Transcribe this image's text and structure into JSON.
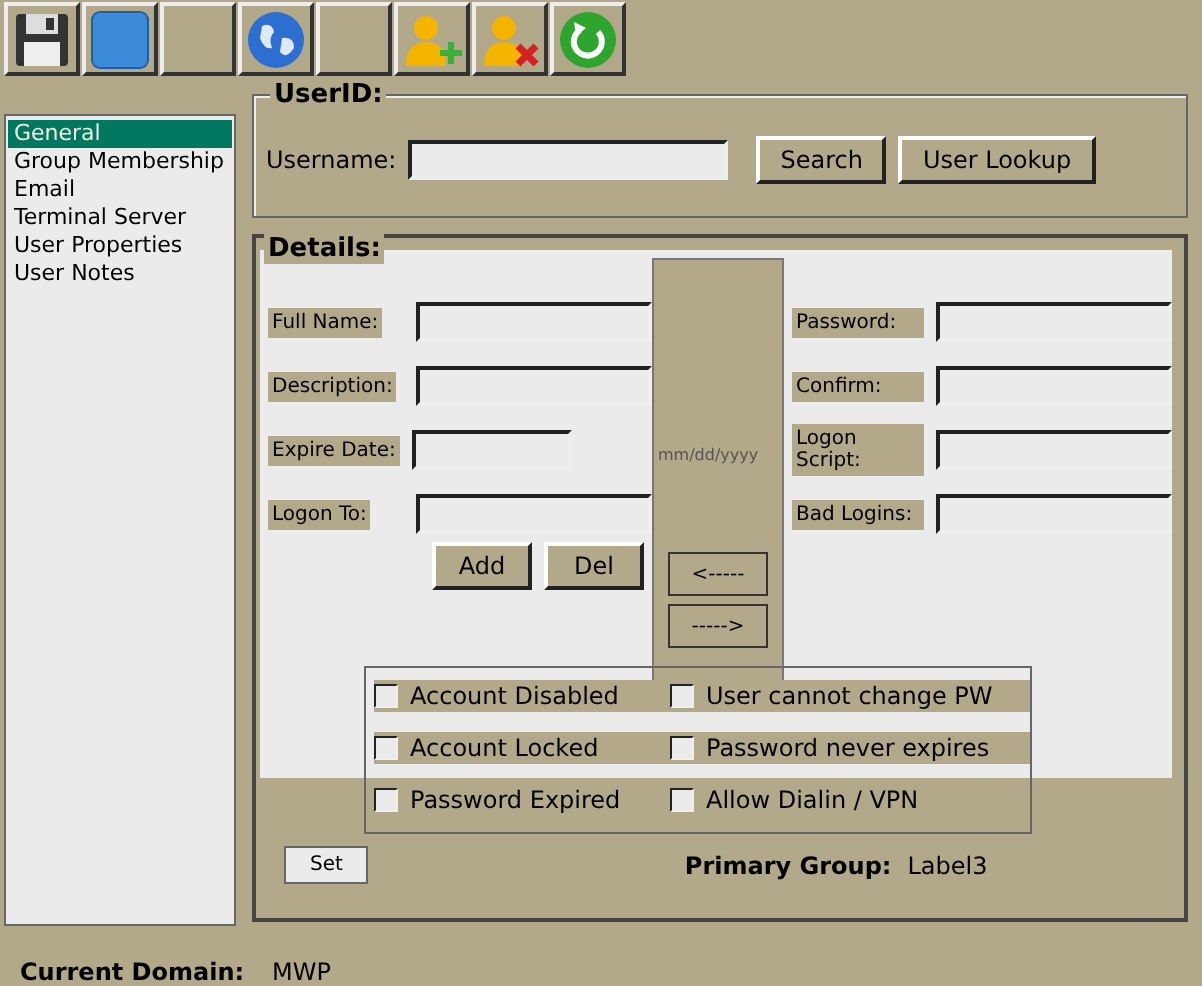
{
  "toolbar": [
    {
      "kind": "save"
    },
    {
      "kind": "square"
    },
    {
      "kind": "blank"
    },
    {
      "kind": "globe"
    },
    {
      "kind": "blank"
    },
    {
      "kind": "user-add"
    },
    {
      "kind": "user-remove"
    },
    {
      "kind": "refresh"
    }
  ],
  "sections": [
    {
      "label": "General",
      "selected": true
    },
    {
      "label": "Group Membership",
      "selected": false
    },
    {
      "label": "Email",
      "selected": false
    },
    {
      "label": "Terminal Server",
      "selected": false
    },
    {
      "label": "User Properties",
      "selected": false
    },
    {
      "label": "User Notes",
      "selected": false
    }
  ],
  "userid": {
    "title": "UserID:",
    "username_label": "Username:",
    "search_button": "Search",
    "lookup_button": "User Lookup"
  },
  "details": {
    "title": "Details:",
    "left_fields": [
      {
        "label": "Full Name:"
      },
      {
        "label": "Description:"
      },
      {
        "label": "Expire Date:",
        "hint": "mm/dd/yyyy"
      },
      {
        "label": "Logon To:"
      }
    ],
    "right_fields": [
      {
        "label": "Password:"
      },
      {
        "label": "Confirm:"
      },
      {
        "label": "Logon Script:"
      },
      {
        "label": "Bad Logins:"
      }
    ],
    "add_button": "Add",
    "del_button": "Del",
    "left_arrow": "<-----",
    "right_arrow": "----->",
    "checkboxes": [
      {
        "label": "Account Disabled",
        "checked": false
      },
      {
        "label": "User cannot change PW",
        "checked": false
      },
      {
        "label": "Account Locked",
        "checked": false
      },
      {
        "label": "Password never expires",
        "checked": false
      },
      {
        "label": "Password Expired",
        "checked": false
      },
      {
        "label": "Allow Dialin / VPN",
        "checked": false
      }
    ],
    "set_button": "Set",
    "primary_group_label": "Primary Group:",
    "primary_group_value": "Label3"
  },
  "status": {
    "label": "Current Domain:",
    "value": "MWP"
  }
}
